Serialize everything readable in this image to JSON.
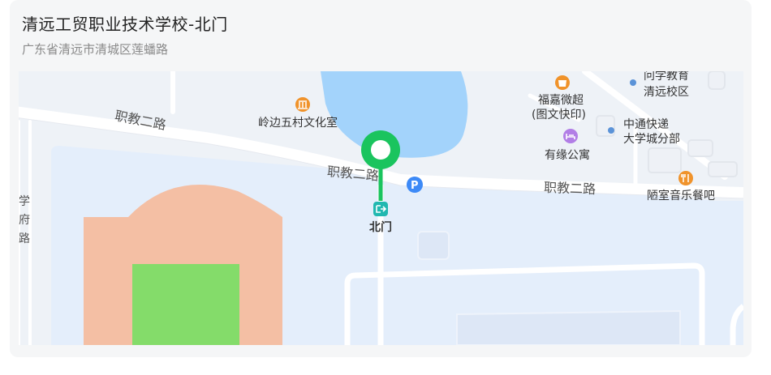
{
  "place": {
    "name": "清远工贸职业技术学校-北门",
    "address": "广东省清远市清城区莲蟠路"
  },
  "map": {
    "marker_label": "北门",
    "roads": {
      "zhijiao_left": "职教二路",
      "zhijiao_mid": "职教二路",
      "zhijiao_right": "职教二路",
      "vertical_left": "学府路"
    },
    "pois": {
      "culture_room": "岭边五村文化室",
      "print_shop_line1": "福嘉微超",
      "print_shop_line2": "(图文快印)",
      "apartment": "有缘公寓",
      "express_line1": "中通快递",
      "express_line2": "大学城分部",
      "education_line1": "问学教育",
      "education_line2": "清远校区",
      "restaurant": "陋室音乐餐吧"
    },
    "colors": {
      "land": "#eef2f7",
      "campus": "#e3eefc",
      "water": "#a3d3fb",
      "track": "#f4bfa4",
      "field": "#84dc6a",
      "marker": "#1ac45e",
      "exit_icon": "#21b8b0",
      "parking": "#3d8af7",
      "poi_orange": "#f0932b",
      "poi_purple": "#b27ee6",
      "poi_blue": "#5b93d8"
    }
  }
}
